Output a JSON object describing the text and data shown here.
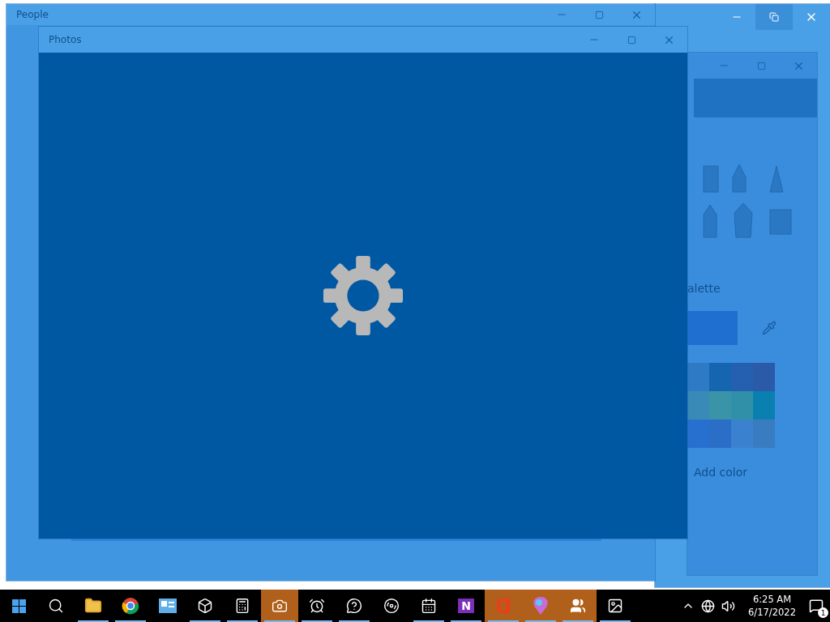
{
  "people_window": {
    "title": "People"
  },
  "photos_window": {
    "title": "Photos"
  },
  "paint_window": {
    "palette_label": "alette",
    "add_color": "Add color",
    "swatches": [
      {
        "color": "#2f7ac4"
      },
      {
        "color": "#1565b0"
      },
      {
        "color": "#245fb0"
      },
      {
        "color": "#2b5aa8"
      },
      {
        "color": "#3a8ab8"
      },
      {
        "color": "#3a94a8"
      },
      {
        "color": "#3090a8"
      },
      {
        "color": "#0a80b0"
      },
      {
        "color": "#2870d0"
      },
      {
        "color": "#2a6ec8"
      },
      {
        "color": "#3a82d0"
      },
      {
        "color": "#3a7cc0"
      }
    ]
  },
  "taskbar": {
    "items": [
      {
        "kind": "start",
        "running": false,
        "active": false
      },
      {
        "kind": "search",
        "running": false,
        "active": false
      },
      {
        "kind": "folder",
        "running": true,
        "active": false
      },
      {
        "kind": "browser",
        "running": true,
        "active": false
      },
      {
        "kind": "panel",
        "running": false,
        "active": false
      },
      {
        "kind": "cube",
        "running": true,
        "active": false
      },
      {
        "kind": "calculator",
        "running": true,
        "active": false
      },
      {
        "kind": "camera",
        "running": true,
        "active": true
      },
      {
        "kind": "alarm",
        "running": true,
        "active": false
      },
      {
        "kind": "help",
        "running": true,
        "active": false
      },
      {
        "kind": "groove",
        "running": false,
        "active": false
      },
      {
        "kind": "calendar",
        "running": true,
        "active": false
      },
      {
        "kind": "note",
        "label": "N",
        "running": true,
        "active": false
      },
      {
        "kind": "office",
        "running": true,
        "active": true
      },
      {
        "kind": "paint",
        "running": true,
        "active": true
      },
      {
        "kind": "people",
        "running": true,
        "active": true
      },
      {
        "kind": "photos",
        "running": true,
        "active": false
      }
    ],
    "time": "6:25 AM",
    "date": "6/17/2022",
    "notification_count": "1"
  }
}
